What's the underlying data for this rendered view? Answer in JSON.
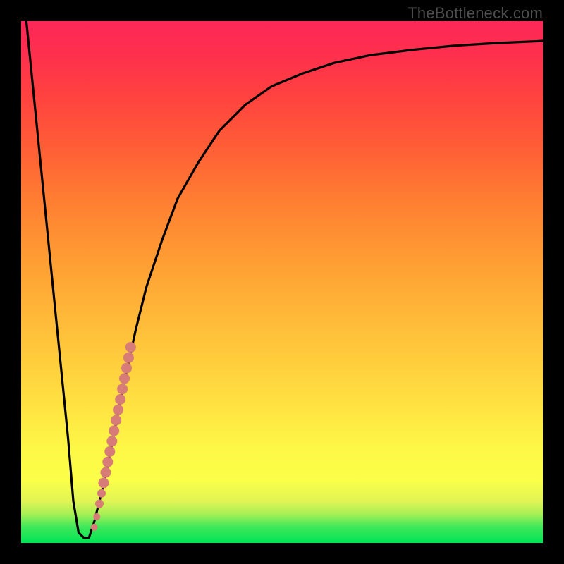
{
  "watermark": "TheBottleneck.com",
  "chart_data": {
    "type": "line",
    "title": "",
    "xlabel": "",
    "ylabel": "",
    "xlim": [
      0,
      100
    ],
    "ylim": [
      0,
      100
    ],
    "series": [
      {
        "name": "bottleneck-curve",
        "x": [
          1,
          3,
          5,
          7,
          9,
          10,
          11,
          12,
          13,
          14,
          16,
          18,
          20,
          22,
          24,
          27,
          30,
          34,
          38,
          43,
          48,
          54,
          60,
          67,
          75,
          83,
          91,
          100
        ],
        "y": [
          100,
          80,
          60,
          40,
          20,
          8,
          2,
          1,
          1,
          4,
          12,
          22,
          32,
          41,
          49,
          58,
          66,
          73,
          79,
          84,
          87.5,
          90,
          92,
          93.5,
          94.5,
          95.3,
          95.8,
          96.2
        ]
      }
    ],
    "scatter": {
      "name": "marker-dots",
      "color": "#d87c78",
      "points": [
        {
          "x": 14.0,
          "y": 3.0
        },
        {
          "x": 14.5,
          "y": 5.0
        },
        {
          "x": 15.0,
          "y": 7.5
        },
        {
          "x": 15.4,
          "y": 9.5
        },
        {
          "x": 15.8,
          "y": 11.5
        },
        {
          "x": 16.2,
          "y": 13.5
        },
        {
          "x": 16.6,
          "y": 15.5
        },
        {
          "x": 17.0,
          "y": 17.5
        },
        {
          "x": 17.4,
          "y": 19.5
        },
        {
          "x": 17.8,
          "y": 21.5
        },
        {
          "x": 18.2,
          "y": 23.5
        },
        {
          "x": 18.6,
          "y": 25.5
        },
        {
          "x": 19.0,
          "y": 27.5
        },
        {
          "x": 19.4,
          "y": 29.5
        },
        {
          "x": 19.8,
          "y": 31.5
        },
        {
          "x": 20.2,
          "y": 33.5
        },
        {
          "x": 20.6,
          "y": 35.5
        },
        {
          "x": 21.0,
          "y": 37.5
        }
      ]
    }
  }
}
